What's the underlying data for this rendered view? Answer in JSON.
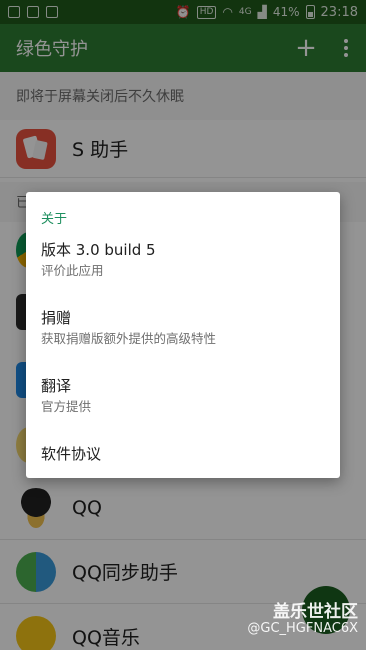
{
  "status_bar": {
    "hd_badge": "HD",
    "network": "4G",
    "battery": "41%",
    "time": "23:18"
  },
  "app_bar": {
    "title": "绿色守护",
    "add_icon": "plus-icon",
    "more_icon": "more-vert-icon"
  },
  "list": {
    "section_1": "即将于屏幕关闭后不久休眠",
    "section_2_partial": "已",
    "rows": [
      {
        "label": "S 助手",
        "icon": "s-assistant-icon"
      },
      {
        "label": "QQ",
        "icon": "qq-icon"
      },
      {
        "label": "QQ同步助手",
        "icon": "qq-sync-icon"
      },
      {
        "label": "QQ音乐",
        "icon": "qq-music-icon"
      }
    ]
  },
  "dialog": {
    "section_label": "关于",
    "items": [
      {
        "title": "版本 3.0 build 5",
        "subtitle": "评价此应用"
      },
      {
        "title": "捐赠",
        "subtitle": "获取捐赠版额外提供的高级特性"
      },
      {
        "title": "翻译",
        "subtitle": "官方提供"
      },
      {
        "title": "软件协议",
        "subtitle": ""
      }
    ]
  },
  "watermark": {
    "line1": "盖乐世社区",
    "line2": "@GC_HGFNAC6X"
  },
  "colors": {
    "status_bar": "#1f5a1b",
    "app_bar": "#2e7d32",
    "accent": "#1e8f5f"
  }
}
